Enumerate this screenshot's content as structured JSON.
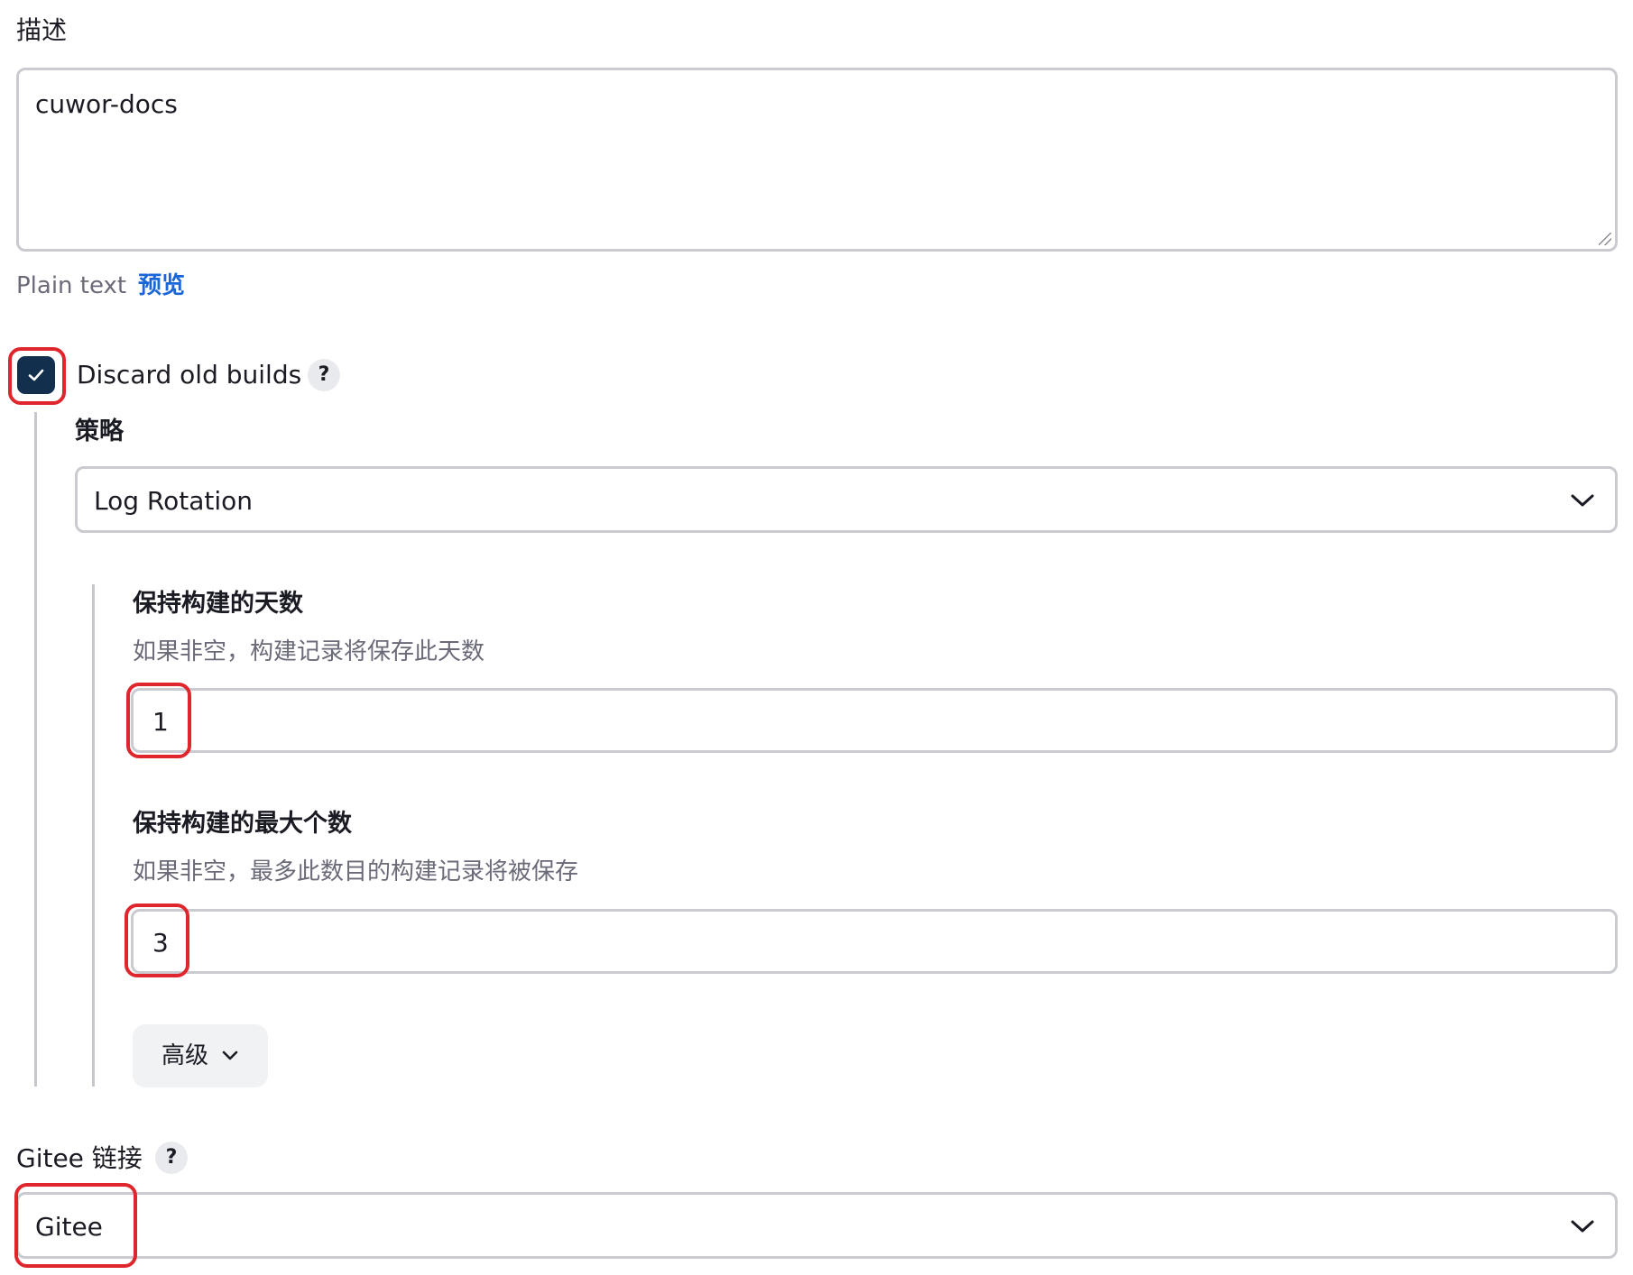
{
  "description": {
    "label": "描述",
    "value": "cuwor-docs",
    "format_label": "Plain text",
    "preview_link": "预览"
  },
  "discard_old_builds": {
    "label": "Discard old builds",
    "checked": true,
    "help": "?",
    "strategy": {
      "label": "策略",
      "selected": "Log Rotation"
    },
    "days_to_keep": {
      "label": "保持构建的天数",
      "help_text": "如果非空，构建记录将保存此天数",
      "value": "1"
    },
    "max_builds": {
      "label": "保持构建的最大个数",
      "help_text": "如果非空，最多此数目的构建记录将被保存",
      "value": "3"
    },
    "advanced_button": "高级"
  },
  "gitee_connection": {
    "label": "Gitee 链接",
    "help": "?",
    "selected": "Gitee"
  },
  "colors": {
    "checkbox_fill": "#12304d",
    "link": "#1a66d8",
    "highlight": "#e0262d"
  }
}
